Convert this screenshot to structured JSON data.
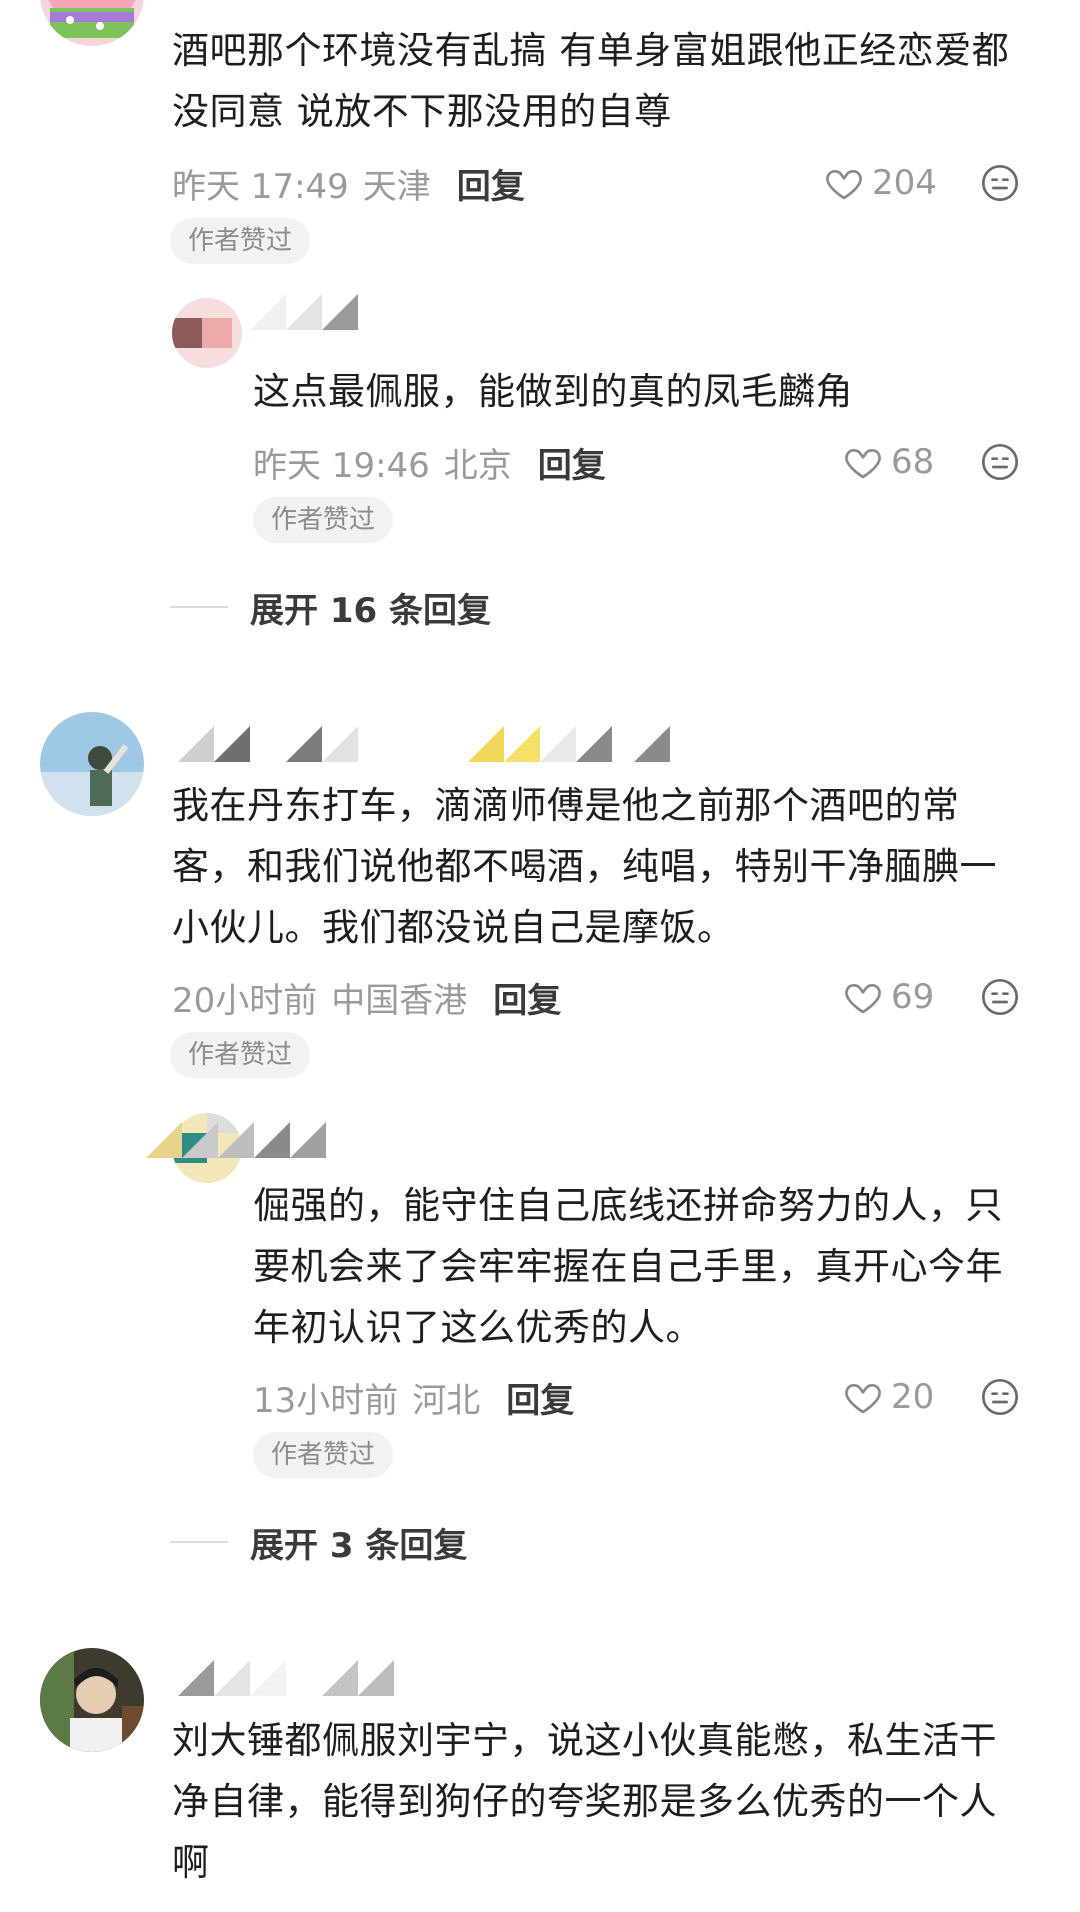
{
  "comments": [
    {
      "text": "酒吧那个环境没有乱搞 有单身富姐跟他正经恋爱都\n没同意 说放不下那没用的自尊",
      "time": "昨天 17:49",
      "location": "天津",
      "reply_label": "回复",
      "likes": "204",
      "badge": "作者赞过",
      "replies": [
        {
          "text": "这点最佩服，能做到的真的凤毛麟角",
          "time": "昨天 19:46",
          "location": "北京",
          "reply_label": "回复",
          "likes": "68",
          "badge": "作者赞过"
        }
      ],
      "expand_label": "展开 16 条回复"
    },
    {
      "text": "我在丹东打车，滴滴师傅是他之前那个酒吧的常\n客，和我们说他都不喝酒，纯唱，特别干净腼腆一\n小伙儿。我们都没说自己是摩饭。",
      "time": "20小时前",
      "location": "中国香港",
      "reply_label": "回复",
      "likes": "69",
      "badge": "作者赞过",
      "replies": [
        {
          "text": "倔强的，能守住自己底线还拼命努力的人，只\n要机会来了会牢牢握在自己手里，真开心今年\n年初认识了这么优秀的人。",
          "time": "13小时前",
          "location": "河北",
          "reply_label": "回复",
          "likes": "20",
          "badge": "作者赞过"
        }
      ],
      "expand_label": "展开 3 条回复"
    },
    {
      "text": "刘大锤都佩服刘宇宁，说这小伙真能憋，私生活干\n净自律，能得到狗仔的夸奖那是多么优秀的一个人\n啊"
    }
  ],
  "icons": {
    "like": "heart-outline-icon",
    "emoji": "neutral-face-icon"
  },
  "colors": {
    "text": "#1e1e1e",
    "meta": "#9a9a9a",
    "badge_bg": "#f2f2f2",
    "patrick_pink": "#f3a7b4"
  }
}
